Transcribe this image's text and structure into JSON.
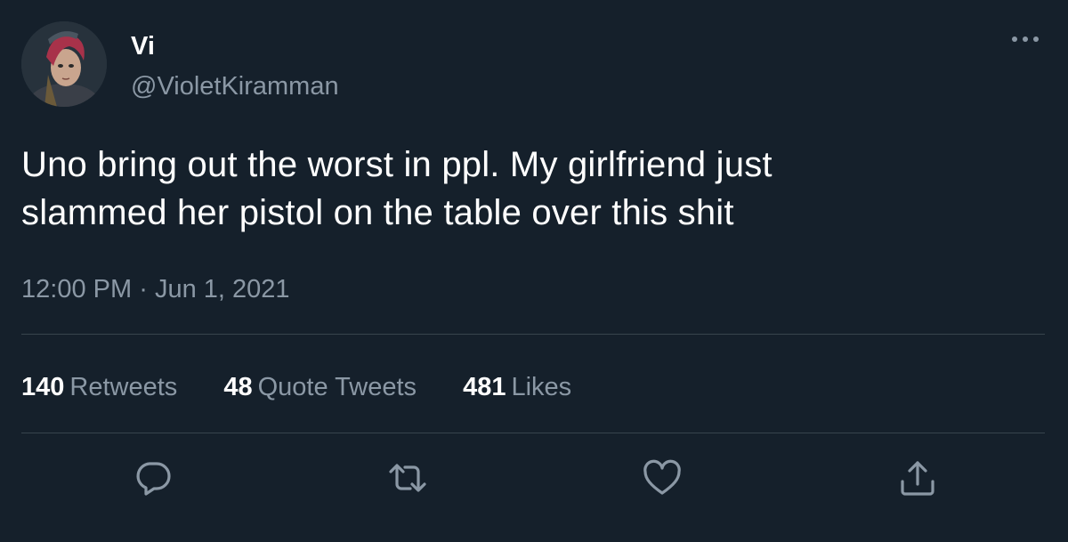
{
  "author": {
    "name": "Vi",
    "handle": "@VioletKiramman"
  },
  "tweet": {
    "text_line1": "Uno bring out the worst in ppl. My girlfriend just",
    "text_line2": "slammed her pistol on the table over this shit",
    "time": "12:00 PM",
    "separator": "·",
    "date": "Jun 1, 2021"
  },
  "stats": [
    {
      "count": "140",
      "label": "Retweets"
    },
    {
      "count": "48",
      "label": "Quote Tweets"
    },
    {
      "count": "481",
      "label": "Likes"
    }
  ],
  "icons": {
    "more": "more-horizontal-icon",
    "reply": "reply-icon",
    "retweet": "retweet-icon",
    "like": "heart-icon",
    "share": "share-icon"
  },
  "colors": {
    "background": "#15202b",
    "primary_text": "#ffffff",
    "secondary_text": "#8b98a5",
    "divider": "#38444d"
  }
}
